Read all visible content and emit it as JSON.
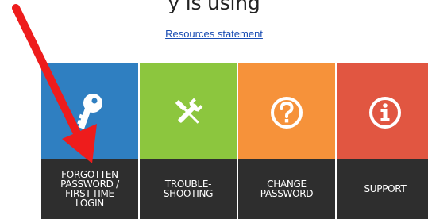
{
  "page": {
    "top_text": "y is using ",
    "resources_link": "Resources statement"
  },
  "tiles": [
    {
      "label": "FORGOTTEN\nPASSWORD /\nFIRST-TIME\nLOGIN",
      "icon": "key-icon",
      "color": "#2f7fc1"
    },
    {
      "label": "TROUBLE-\nSHOOTING",
      "icon": "tools-icon",
      "color": "#8cc63e"
    },
    {
      "label": "CHANGE\nPASSWORD",
      "icon": "question-icon",
      "color": "#f6923a"
    },
    {
      "label": "SUPPORT",
      "icon": "info-icon",
      "color": "#e15641"
    }
  ],
  "annotation": {
    "arrow_color": "#ee1c1c"
  }
}
